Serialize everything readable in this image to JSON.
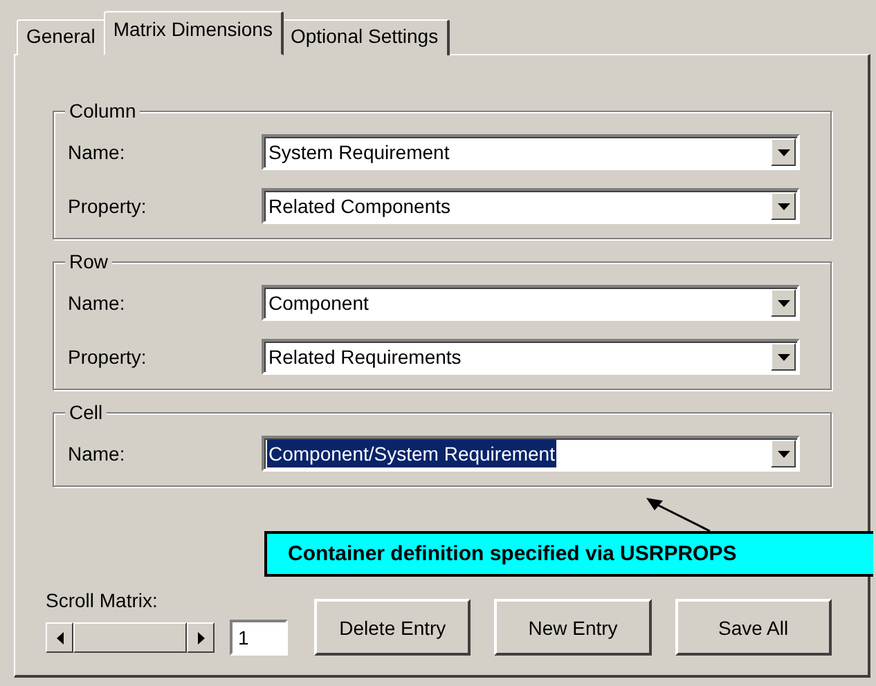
{
  "tabs": [
    {
      "label": "General",
      "selected": false
    },
    {
      "label": "Matrix Dimensions",
      "selected": true
    },
    {
      "label": "Optional Settings",
      "selected": false
    }
  ],
  "groups": [
    {
      "title": "Column",
      "fields": [
        {
          "label": "Name:",
          "value": "System Requirement",
          "highlighted": false
        },
        {
          "label": "Property:",
          "value": "Related Components",
          "highlighted": false
        }
      ]
    },
    {
      "title": "Row",
      "fields": [
        {
          "label": "Name:",
          "value": "Component",
          "highlighted": false
        },
        {
          "label": "Property:",
          "value": "Related Requirements",
          "highlighted": false
        }
      ]
    },
    {
      "title": "Cell",
      "fields": [
        {
          "label": "Name:",
          "value": "Component/System Requirement",
          "highlighted": true
        }
      ]
    }
  ],
  "callout": {
    "text": "Container definition specified via USRPROPS"
  },
  "scroll_matrix": {
    "label": "Scroll Matrix:",
    "value": "1"
  },
  "buttons": [
    "Delete Entry",
    "New Entry",
    "Save All"
  ]
}
